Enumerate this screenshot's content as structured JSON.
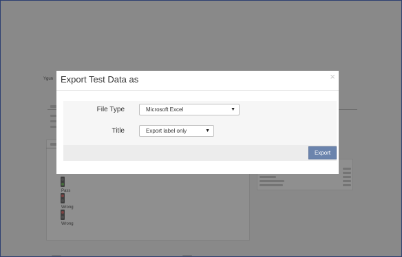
{
  "modal": {
    "title": "Export Test Data as",
    "close_glyph": "×",
    "fields": {
      "file_type": {
        "label": "File Type",
        "value": "Microsoft Excel"
      },
      "title": {
        "label": "Title",
        "value": "Export label only"
      }
    },
    "export_label": "Export",
    "caret_glyph": "▼"
  },
  "background": {
    "text_1": "Ygun",
    "row_1": "Pass",
    "row_2": "Wrong",
    "row_3": "Wrong"
  },
  "colors": {
    "overlay": "rgba(0,0,0,0.42)",
    "export_button": "#6b84ad",
    "window_border": "#2c3e70"
  }
}
